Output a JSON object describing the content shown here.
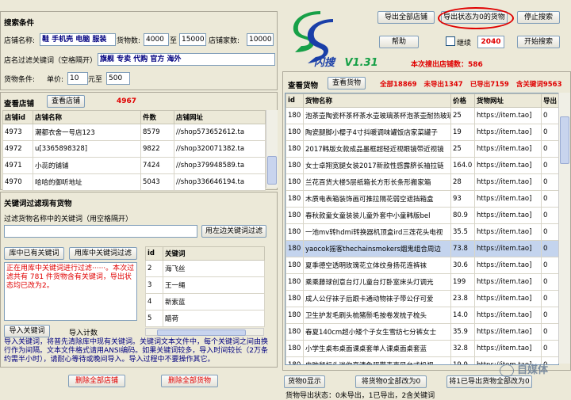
{
  "search_conditions": {
    "title": "搜索条件",
    "shop_name_label": "店铺名称:",
    "shop_name_value": "鞋 手机壳 电脑 服装",
    "goods_count_label": "货物数:",
    "goods_min": "4000",
    "to": "至",
    "goods_max": "15000",
    "shop_count_label": "店铺家数:",
    "shop_count": "10000",
    "filter_label": "店名过滤关键词（空格隔开）",
    "filter_value": "旗舰 专卖 代购 官方 海外",
    "goods_cond_label": "货物条件:",
    "price_label": "单价:",
    "price_min": "10",
    "price_to": "元至",
    "price_max": "500"
  },
  "shops": {
    "title": "查看店铺",
    "view_button": "查看店铺",
    "count": "4967",
    "headers": [
      "店铺id",
      "店铺名称",
      "件数",
      "店铺网址"
    ],
    "rows": [
      [
        "4973",
        "潮都衣舍一号店123",
        "8579",
        "//shop573652612.ta"
      ],
      [
        "4972",
        "u[3365898328]",
        "9822",
        "//shop320071382.ta"
      ],
      [
        "4971",
        "小蕊的铺铺",
        "7424",
        "//shop379948589.ta"
      ],
      [
        "4970",
        "哈哈的御听地址",
        "5043",
        "//shop336646194.ta"
      ]
    ]
  },
  "keyword_filter": {
    "title": "关键词过滤现有货物",
    "desc": "过滤货物名称中的关键词（用空格隔开）",
    "filter_button": "用左边关键词过滤",
    "existing_button": "库中已有关键词",
    "library_button": "用库中关键词过滤",
    "log": "正在用库中关键词进行过滤······。本次过滤共有 781 件货物含有关键词，导出状态均已改为2。",
    "kw_headers": [
      "id",
      "关键词"
    ],
    "keywords": [
      [
        "2",
        "海飞丝"
      ],
      [
        "3",
        "王一绳"
      ],
      [
        "4",
        "新索蓝"
      ],
      [
        "5",
        "醋荷"
      ]
    ],
    "import_button": "导入关键词",
    "import_count_label": "导入计数",
    "import_note": "导入关键词，将普先清除库中现有关键词。关键词文本文件中，每个关键词之间由换行作为间隔。文本文件格式请用ANSI编码。如果关键词较多，导入时间较长（2万条约需半小时），请耐心等待或晚间导入。导入过程中不要操作其它。"
  },
  "bottom_left": {
    "delete_shops": "删除全部店铺",
    "delete_goods": "删除全部货物"
  },
  "app": {
    "name": "闪搜",
    "version": "V1.31",
    "current_shops_label": "本次搜出店铺数：",
    "current_shops": "586"
  },
  "top_right": {
    "export_all_shops": "导出全部店铺",
    "export_zero": "导出状态为0的货物",
    "stop_search": "停止搜索",
    "help": "帮助",
    "continue_label": "继续",
    "continue_value": "2040",
    "start_search": "开始搜索"
  },
  "goods": {
    "title": "查看货物",
    "view_button": "查看货物",
    "total": "全部18869",
    "not_exported": "未导出1347",
    "exported": "已导出7159",
    "keyword_count": "含关键词9563",
    "headers": [
      "id",
      "货物名称",
      "价格",
      "货物网址",
      "导出"
    ],
    "rows": [
      [
        "180",
        "泡茶壶陶瓷杯茶杯茶水壶玻璃茶杯泡茶壶耐热玻璃",
        "25",
        "https://item.tao]",
        "0"
      ],
      [
        "180",
        "陶瓷腿脚小樱子4寸抖暖调味罐饭店家菜罐子",
        "19",
        "https://item.tao]",
        "0"
      ],
      [
        "180",
        "2017韩版女款成品墨框超轻近视眼镜带近视镜",
        "25",
        "https://item.tao]",
        "0"
      ],
      [
        "180",
        "女士卓翔宽腿女装2017新款性感露脐长袖拉链",
        "164.0",
        "https://item.tao]",
        "0"
      ],
      [
        "180",
        "兰花百货大楼5层纸箱长方形长条形搬家箱",
        "28",
        "https://item.tao]",
        "0"
      ],
      [
        "180",
        "木质电表箱装饰画可推拉隔花弱空遮挡箱盒",
        "93",
        "https://item.tao]",
        "0"
      ],
      [
        "180",
        "春秋款童女童装装儿童外套中小童韩版bel",
        "80.9",
        "https://item.tao]",
        "0"
      ],
      [
        "180",
        "一池mv转hdmi转换器机顶盒ird三莲花头电视",
        "35.5",
        "https://item.tao]",
        "0"
      ],
      [
        "180",
        "yaocok摇客thechainsmokers烟鬼组合周边",
        "73.8",
        "https://item.tao]",
        "0"
      ],
      [
        "180",
        "夏季德空透明玫瑰花立体纹身扬花连裤袜",
        "30.6",
        "https://item.tao]",
        "0"
      ],
      [
        "180",
        "乘乘藤球创意台灯儿童台灯卧室床头灯调光",
        "199",
        "https://item.tao]",
        "0"
      ],
      [
        "180",
        "成人公仔袜子后跟卡通动物袜子带公仔可爱",
        "23.8",
        "https://item.tao]",
        "0"
      ],
      [
        "180",
        "卫生护发毛刷头梳猪鬃毛按卷发梳子梳头",
        "14.0",
        "https://item.tao]",
        "0"
      ],
      [
        "180",
        "春夏140cm超小矮个子女生雪纺七分裤女士",
        "35.9",
        "https://item.tao]",
        "0"
      ],
      [
        "180",
        "小学生桌布桌面课桌套单人课桌面桌套蓝",
        "32.8",
        "https://item.tao]",
        "0"
      ],
      [
        "180",
        "电脑鼠标头迷你高清免驱带麦克风台式机视",
        "19.9",
        "https://item.tao]",
        "0"
      ],
      [
        "180",
        "蒙彼娜时尚尖头单鞋女鞋子高跟浅口鞋",
        "36.5",
        "https://item.tao]",
        "0"
      ]
    ],
    "selected_index": 8,
    "show_zero": "货物0显示",
    "set_zero": "将货物0全部改为0",
    "set_exported": "将1已导出货物全部改为0",
    "status_note": "货物导出状态：0未导出，1已导出，2含关键词"
  },
  "watermark": "自媒体",
  "colors": {
    "accent_red": "#e00000",
    "logo_green": "#17a047",
    "logo_blue": "#1a3fa8"
  }
}
